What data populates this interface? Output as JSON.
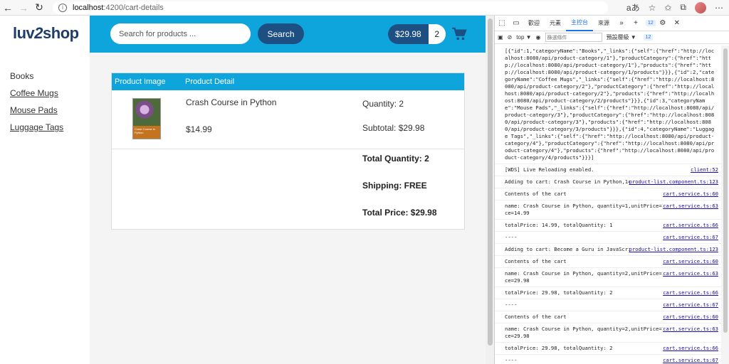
{
  "browser": {
    "url_host": "localhost",
    "url_path": ":4200/cart-details",
    "info_icon": "info-icon"
  },
  "app": {
    "logo_text_a": "luv",
    "logo_text_b": "2",
    "logo_text_c": "shop",
    "search_placeholder": "Search for products ...",
    "search_button": "Search",
    "cart_total": "$29.98",
    "cart_qty": "2",
    "categories": [
      "Books",
      "Coffee Mugs",
      "Mouse Pads",
      "Luggage Tags"
    ],
    "table_headers": {
      "image": "Product Image",
      "detail": "Product Detail"
    },
    "product": {
      "name": "Crash Course in Python",
      "price": "$14.99",
      "quantity": "Quantity: 2",
      "subtotal": "Subtotal: $29.98",
      "cover_text": "Crash Course in Python"
    },
    "totals": {
      "total_quantity": "Total Quantity: 2",
      "shipping": "Shipping: FREE",
      "total_price": "Total Price: $29.98"
    },
    "colors": {
      "header": "#0ea5dc",
      "button": "#1d4f82"
    }
  },
  "devtools": {
    "tabs": [
      "歡迎",
      "元素",
      "主控台",
      "來源"
    ],
    "active_tab": "主控台",
    "issues_count": "12",
    "context": "top ▼",
    "filter_placeholder": "篩選條件",
    "levels": "預設層級 ▼",
    "entries": [
      {
        "text": "[{\"id\":1,\"categoryName\":\"Books\",\"_links\":{\"self\":{\"href\":\"http://localhost:8080/api/product-category/1\"},\"productCategory\":{\"href\":\"http://localhost:8080/api/product-category/1\"},\"products\":{\"href\":\"http://localhost:8080/api/product-category/1/products\"}}},{\"id\":2,\"categoryName\":\"Coffee Mugs\",\"_links\":{\"self\":{\"href\":\"http://localhost:8080/api/product-category/2\"},\"productCategory\":{\"href\":\"http://localhost:8080/api/product-category/2\"},\"products\":{\"href\":\"http://localhost:8080/api/product-category/2/products\"}}},{\"id\":3,\"categoryName\":\"Mouse Pads\",\"_links\":{\"self\":{\"href\":\"http://localhost:8080/api/product-category/3\"},\"productCategory\":{\"href\":\"http://localhost:8080/api/product-category/3\"},\"products\":{\"href\":\"http://localhost:8080/api/product-category/3/products\"}}},{\"id\":4,\"categoryName\":\"Luggage Tags\",\"_links\":{\"self\":{\"href\":\"http://localhost:8080/api/product-category/4\"},\"productCategory\":{\"href\":\"http://localhost:8080/api/product-category/4\"},\"products\":{\"href\":\"http://localhost:8080/api/product-category/4/products\"}}}]",
        "src": ""
      },
      {
        "text": "[WDS] Live Reloading enabled.",
        "src": "client:52"
      },
      {
        "text": "Adding to cart: Crash Course in Python,14.99",
        "src": "product-list.component.ts:123"
      },
      {
        "text": "Contents of the cart",
        "src": "cart.service.ts:60"
      },
      {
        "text": "name: Crash Course in Python, quantity=1,unitPrice=14.99,subTotalPrice=14.99",
        "src": "cart.service.ts:63"
      },
      {
        "text": "totalPrice: 14.99, totalQuantity: 1",
        "src": "cart.service.ts:66"
      },
      {
        "text": "----",
        "src": "cart.service.ts:67"
      },
      {
        "text": "Adding to cart: Become a Guru in JavaScript,20.99",
        "src": "product-list.component.ts:123"
      },
      {
        "text": "Contents of the cart",
        "src": "cart.service.ts:60"
      },
      {
        "text": "name: Crash Course in Python, quantity=2,unitPrice=14.99,subTotalPrice=29.98",
        "src": "cart.service.ts:63"
      },
      {
        "text": "totalPrice: 29.98, totalQuantity: 2",
        "src": "cart.service.ts:66"
      },
      {
        "text": "----",
        "src": "cart.service.ts:67"
      },
      {
        "text": "Contents of the cart",
        "src": "cart.service.ts:60"
      },
      {
        "text": "name: Crash Course in Python, quantity=2,unitPrice=14.99,subTotalPrice=29.98",
        "src": "cart.service.ts:63"
      },
      {
        "text": "totalPrice: 29.98, totalQuantity: 2",
        "src": "cart.service.ts:66"
      },
      {
        "text": "----",
        "src": "cart.service.ts:67"
      }
    ],
    "prompt": ">"
  }
}
